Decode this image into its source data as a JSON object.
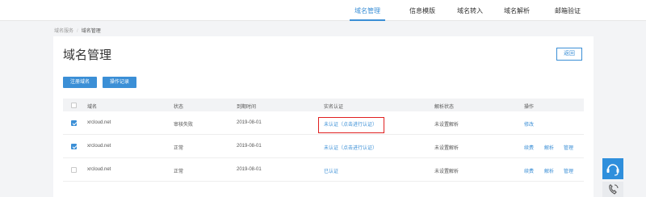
{
  "nav": {
    "items": [
      "域名管理",
      "信息模版",
      "域名转入",
      "域名解析",
      "邮箱验证"
    ],
    "active_index": 0
  },
  "breadcrumb": {
    "parent": "域名服务",
    "separator": "/",
    "current": "域名管理"
  },
  "page": {
    "title": "域名管理",
    "back_label": "返回"
  },
  "actions": {
    "register_label": "注册域名",
    "log_label": "操作记录"
  },
  "table": {
    "headers": [
      "域名",
      "状态",
      "到期时间",
      "实名认证",
      "解析状态",
      "操作"
    ],
    "rows": [
      {
        "checked": true,
        "domain": "xrcloud.net",
        "status": "审核失败",
        "expire": "2019-08-01",
        "realname": "未认证（点击进行认证）",
        "dns": "未设置解析",
        "ops": [
          "修改"
        ]
      },
      {
        "checked": true,
        "domain": "xrcloud.net",
        "status": "正常",
        "expire": "2019-08-01",
        "realname": "未认证（点击进行认证）",
        "dns": "未设置解析",
        "ops": [
          "续费",
          "解析",
          "管理"
        ]
      },
      {
        "checked": false,
        "domain": "xrcloud.net",
        "status": "正常",
        "expire": "2019-08-01",
        "realname": "已认证",
        "dns": "未设置解析",
        "ops": [
          "续费",
          "解析",
          "管理"
        ]
      }
    ]
  },
  "colors": {
    "accent": "#3b8fd6",
    "highlight": "#e02020"
  },
  "icons": {
    "float_top": "headset-icon",
    "float_bottom": "phone-icon"
  }
}
